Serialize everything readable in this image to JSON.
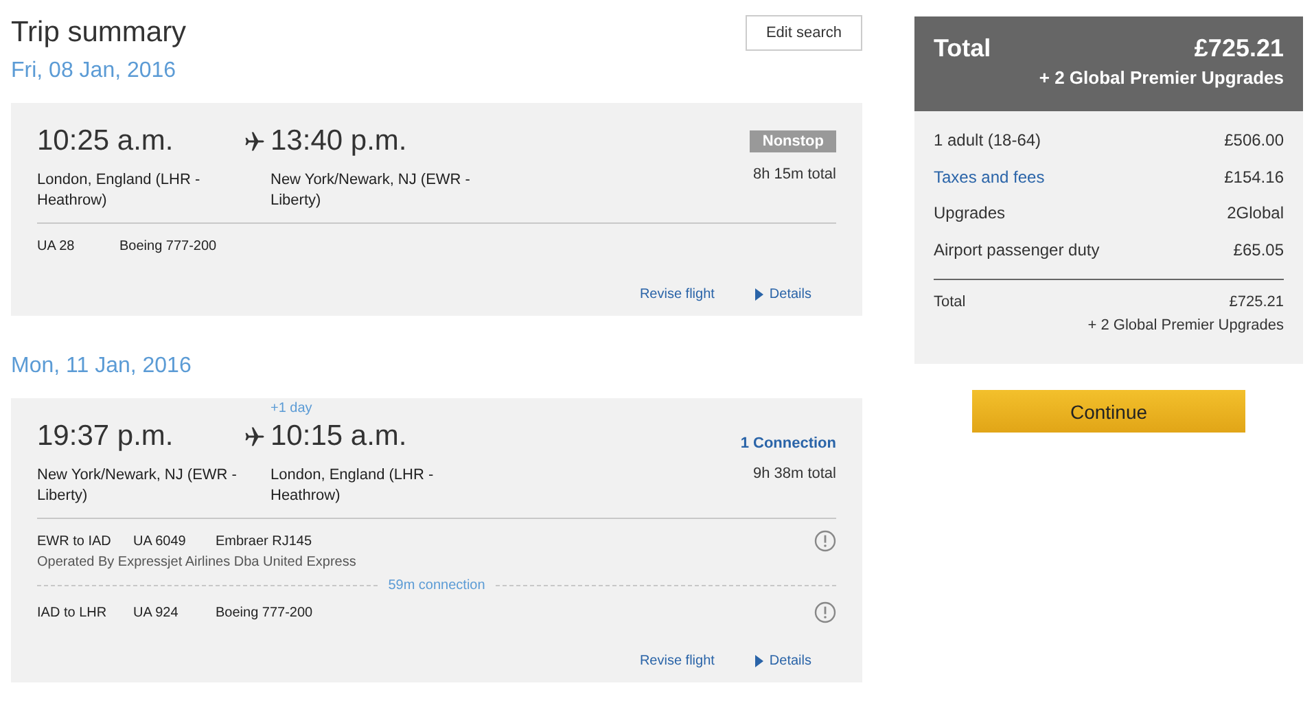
{
  "header": {
    "title": "Trip summary",
    "edit_button": "Edit search"
  },
  "trips": [
    {
      "date": "Fri, 08 Jan, 2016",
      "depart_time": "10:25 a.m.",
      "depart_city": "London, England (LHR - Heathrow)",
      "arrive_time": "13:40 p.m.",
      "arrive_city": "New York/Newark, NJ (EWR - Liberty)",
      "stops": {
        "kind": "tag",
        "label": "Nonstop"
      },
      "duration": "8h 15m total",
      "segments": [
        {
          "flight": "UA 28",
          "aircraft": "Boeing 777-200",
          "warning": false
        }
      ],
      "links": [
        "Revise flight",
        "Details"
      ]
    },
    {
      "date": "Mon, 11 Jan, 2016",
      "depart_time": "19:37 p.m.",
      "depart_city": "New York/Newark, NJ (EWR - Liberty)",
      "day_offset": "+1 day",
      "arrive_time": "10:15 a.m.",
      "arrive_city": "London, England (LHR - Heathrow)",
      "stops": {
        "kind": "link",
        "label": "1 Connection"
      },
      "duration": "9h 38m total",
      "segments": [
        {
          "route": "EWR to IAD",
          "flight": "UA 6049",
          "aircraft": "Embraer RJ145",
          "operator": "Operated By Expressjet Airlines Dba United Express",
          "warning": true,
          "connection": "59m connection"
        },
        {
          "route": "IAD to LHR",
          "flight": "UA 924",
          "aircraft": "Boeing 777-200",
          "warning": true
        }
      ],
      "links": [
        "Revise flight",
        "Details"
      ]
    }
  ],
  "summary": {
    "title": "Total",
    "total": "£725.21",
    "total_extra": "+ 2 Global Premier Upgrades",
    "lines": [
      {
        "label": "1 adult (18-64)",
        "value": "£506.00",
        "kind": "text"
      },
      {
        "label": "Taxes and fees",
        "value": "£154.16",
        "kind": "link"
      },
      {
        "label": "Upgrades",
        "value": "2Global",
        "kind": "text"
      },
      {
        "label": "Airport passenger duty",
        "value": "£65.05",
        "kind": "text"
      }
    ],
    "footer_label": "Total",
    "footer_total": "£725.21",
    "footer_extra": "+ 2 Global Premier Upgrades"
  },
  "continue_button": "Continue"
}
